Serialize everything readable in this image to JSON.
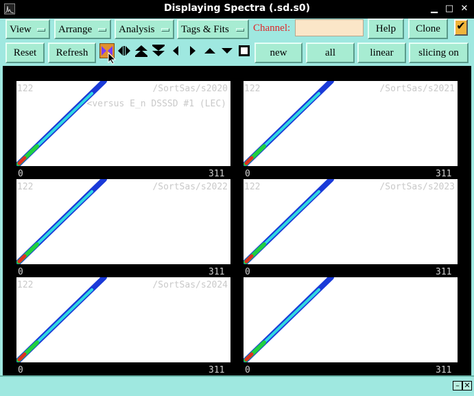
{
  "window": {
    "title": "Displaying Spectra (.sd.s0)"
  },
  "toolbar": {
    "menus": {
      "view": "View",
      "arrange": "Arrange",
      "analysis": "Analysis",
      "tags": "Tags & Fits"
    },
    "channel_label": "Channel:",
    "channel_value": "",
    "help": "Help",
    "clone": "Clone",
    "reset": "Reset",
    "refresh": "Refresh",
    "new": "new",
    "all": "all",
    "linear": "linear",
    "slicing": "slicing on"
  },
  "icons": [
    "zoom-in-icon",
    "expand-horizontal-icon",
    "expand-up-icon",
    "expand-down-icon",
    "arrow-left-icon",
    "arrow-right-icon",
    "arrow-up-icon",
    "arrow-down-icon",
    "full-view-icon"
  ],
  "panels": [
    {
      "name": "/SortSas/s2020",
      "count_label": "122",
      "subtitle": "<versus E_n DSSSD #1 (LEC)",
      "x_min": "0",
      "x_max": "311"
    },
    {
      "name": "/SortSas/s2021",
      "count_label": "122",
      "subtitle": "",
      "x_min": "0",
      "x_max": "311"
    },
    {
      "name": "/SortSas/s2022",
      "count_label": "122",
      "subtitle": "",
      "x_min": "0",
      "x_max": "311"
    },
    {
      "name": "/SortSas/s2023",
      "count_label": "122",
      "subtitle": "",
      "x_min": "0",
      "x_max": "311"
    },
    {
      "name": "/SortSas/s2024",
      "count_label": "122",
      "subtitle": "",
      "x_min": "0",
      "x_max": "311"
    },
    {
      "name": "",
      "count_label": "",
      "subtitle": "",
      "x_min": "0",
      "x_max": "311"
    }
  ],
  "colors": {
    "band_hot": "#e03020",
    "band_mid": "#20d040",
    "band_cool": "#30d8e0",
    "band_edge": "#1a3ad8",
    "accent": "#f0b43c"
  }
}
